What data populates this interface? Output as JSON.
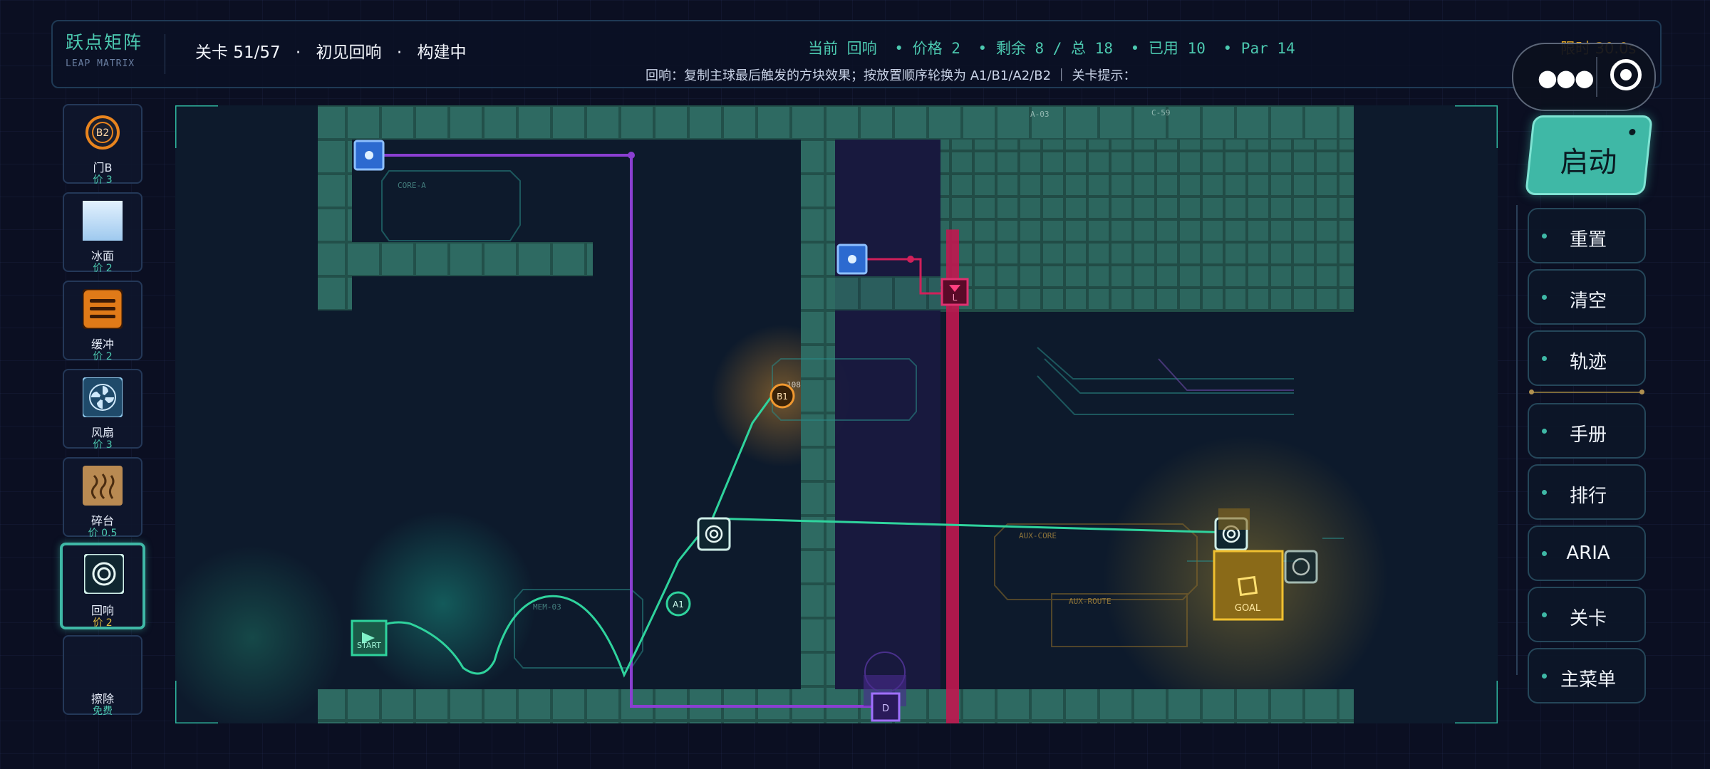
{
  "header": {
    "logo_title": "跃点矩阵",
    "logo_subtitle": "LEAP MATRIX",
    "level": "关卡 51/57",
    "level_name": "初见回响",
    "state": "构建中",
    "stats": [
      "当前 回响",
      "• 价格 2",
      "• 剩余 8 / 总 18",
      "• 已用 10",
      "• Par 14"
    ],
    "hint": "回响：复制主球最后触发的方块效果；按放置顺序轮换为 A1/B1/A2/B2 ｜ 关卡提示：",
    "timer": "限时 30.0s"
  },
  "palette": [
    {
      "name": "门B",
      "price": "价 3",
      "icon": "gate-b-icon",
      "icon_text": "B2"
    },
    {
      "name": "冰面",
      "price": "价 2",
      "icon": "ice-icon",
      "icon_text": ""
    },
    {
      "name": "缓冲",
      "price": "价 2",
      "icon": "buffer-icon",
      "icon_text": ""
    },
    {
      "name": "风扇",
      "price": "价 3",
      "icon": "fan-icon",
      "icon_text": ""
    },
    {
      "name": "碎台",
      "price": "价 0.5",
      "icon": "crumble-icon",
      "icon_text": ""
    },
    {
      "name": "回响",
      "price": "价 2",
      "icon": "echo-icon",
      "icon_text": ""
    },
    {
      "name": "擦除",
      "price": "免费",
      "icon": "eraser-icon",
      "icon_text": ""
    }
  ],
  "board": {
    "start_label": "START",
    "goal_label": "GOAL",
    "node_a1": "A1",
    "node_b1": "B1",
    "node_d": "D",
    "node_l": "L",
    "deco_labels": [
      "CORE-A",
      "MEM-03",
      "AUX-CORE",
      "AUX-ROUTE",
      "A-03",
      "C-59",
      "108"
    ]
  },
  "right": {
    "start_label": "启动",
    "buttons": [
      "重置",
      "清空",
      "轨迹",
      "手册",
      "排行",
      "ARIA",
      "关卡",
      "主菜单"
    ]
  },
  "colors": {
    "accent": "#3fb8a6",
    "path": "#2fd39d",
    "purple_wire": "#8a3fd1",
    "laser": "#d0205a",
    "goal": "#e5b020",
    "portal_blue": "#3a8ae8"
  }
}
